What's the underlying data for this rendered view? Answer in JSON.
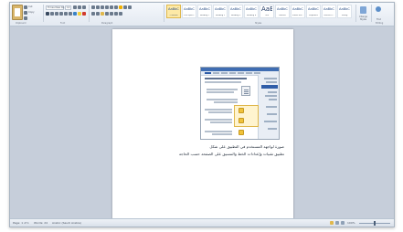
{
  "ribbon": {
    "font_name": "Times New Ro",
    "font_size": "14",
    "clipboard_label": "Clipboard",
    "font_group_label": "Font",
    "paragraph_label": "Paragraph",
    "styles_label": "Styles",
    "editing_label": "Editing",
    "styles": [
      {
        "preview": "AaBbCcD",
        "name": "¶ Normal"
      },
      {
        "preview": "AaBbCcD",
        "name": "¶ No Spaci..."
      },
      {
        "preview": "AaBbC",
        "name": "Heading 1"
      },
      {
        "preview": "AaBbCc",
        "name": "Heading 2"
      },
      {
        "preview": "AaBbCc",
        "name": "Heading 3"
      },
      {
        "preview": "AaBbCc",
        "name": "Heading 4"
      },
      {
        "preview": "AaB",
        "name": "Title"
      },
      {
        "preview": "AaBbCc",
        "name": "Subtitle"
      },
      {
        "preview": "AaBbCcD",
        "name": "Subtle Em..."
      },
      {
        "preview": "AaBbCcD",
        "name": "Emphasis"
      },
      {
        "preview": "AaBbCcD",
        "name": "Intense E..."
      },
      {
        "preview": "AaBbCcD",
        "name": "Strong"
      }
    ],
    "change_styles_label": "Change Styles",
    "find_label": "Find"
  },
  "document": {
    "caption_line1": "صورة لواجهة المستخدم في التطبيق على شكل",
    "caption_line2": "تطبيق تقنيات وإعدادات الخط والتنسيق على الصفحة حسب الحاجة"
  },
  "statusbar": {
    "page": "Page: 1 of 1",
    "words": "Words: 24",
    "language": "Arabic (Saudi Arabia)",
    "zoom": "100%"
  }
}
